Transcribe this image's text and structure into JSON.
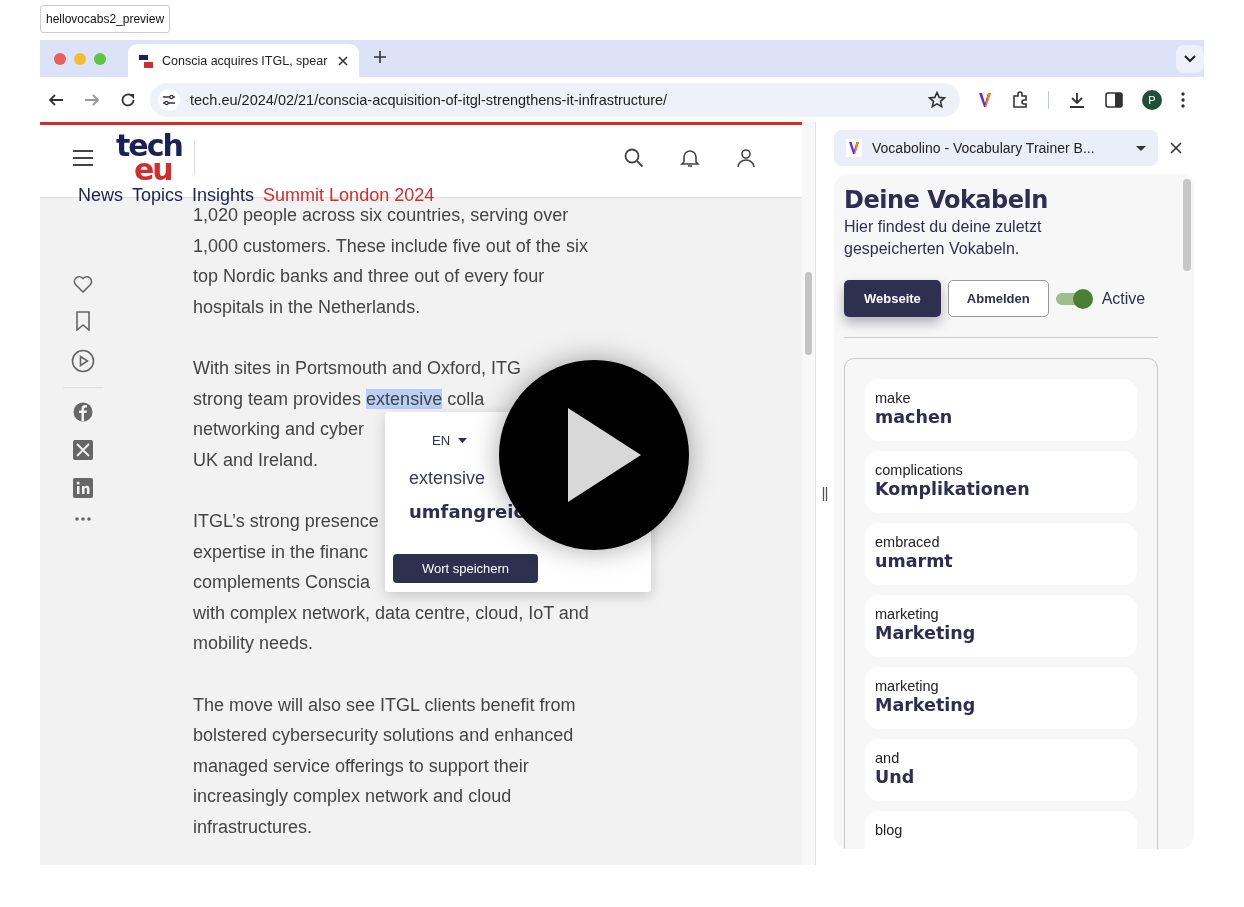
{
  "preview_label": "hellovocabs2_preview",
  "tabs": [
    {
      "title": "Conscia acquires ITGL, spear",
      "selected": true
    }
  ],
  "address_bar": {
    "url": "tech.eu/2024/02/21/conscia-acquisition-of-itgl-strengthens-it-infrastructure/"
  },
  "profile_initial": "P",
  "site": {
    "logo_top": "tech",
    "logo_bottom": "eu",
    "nav": [
      {
        "label": "News",
        "highlight": false
      },
      {
        "label": "Topics",
        "highlight": false
      },
      {
        "label": "Insights",
        "highlight": false
      },
      {
        "label": "Summit London 2024",
        "highlight": true
      }
    ]
  },
  "article": {
    "paragraphs": [
      {
        "lines": [
          {
            "text": "1,020 people across six countries, serving over"
          },
          {
            "text": "1,000 customers. These include five out of the six"
          },
          {
            "text": "top Nordic banks and three out of every four"
          },
          {
            "text": "hospitals in the Netherlands."
          }
        ]
      },
      {
        "lines": [
          {
            "text": "With sites in Portsmouth and Oxford, ITG"
          },
          {
            "text": "strong team provides ",
            "selected_word": "extensive",
            "rest": " colla"
          },
          {
            "text": "networking and cyber"
          },
          {
            "text": "UK and Ireland."
          }
        ]
      },
      {
        "lines": [
          {
            "text": "ITGL’s strong presence"
          },
          {
            "text": "expertise in the financ"
          },
          {
            "text": "complements Conscia"
          },
          {
            "text": "with complex network, data centre, cloud, IoT and"
          },
          {
            "text": "mobility needs."
          }
        ]
      },
      {
        "lines": [
          {
            "text": " The move will also see ITGL clients benefit from"
          },
          {
            "text": "bolstered cybersecurity solutions and enhanced"
          },
          {
            "text": "managed service offerings to support their"
          },
          {
            "text": "increasingly complex network and cloud"
          },
          {
            "text": "infrastructures."
          }
        ]
      }
    ]
  },
  "translation_popup": {
    "language": "EN",
    "source": "extensive",
    "translation": "umfangreic",
    "save_button": "Wort speichern"
  },
  "side_panel": {
    "extension_title": "Vocabolino - Vocabulary Trainer B...",
    "heading": "Deine Vokabeln",
    "description": "Hier findest du deine zuletzt gespeicherten Vokabeln.",
    "buttons": [
      {
        "label": "Webseite",
        "kind": "primary"
      },
      {
        "label": "Abmelden",
        "kind": "secondary"
      }
    ],
    "toggle": {
      "label": "Active",
      "on": true
    },
    "vocab": [
      {
        "word": "make",
        "translation": "machen"
      },
      {
        "word": "complications",
        "translation": "Komplikationen"
      },
      {
        "word": "embraced",
        "translation": "umarmt"
      },
      {
        "word": "marketing",
        "translation": "Marketing"
      },
      {
        "word": "marketing",
        "translation": "Marketing"
      },
      {
        "word": "and",
        "translation": "Und"
      },
      {
        "word": "blog"
      }
    ]
  }
}
